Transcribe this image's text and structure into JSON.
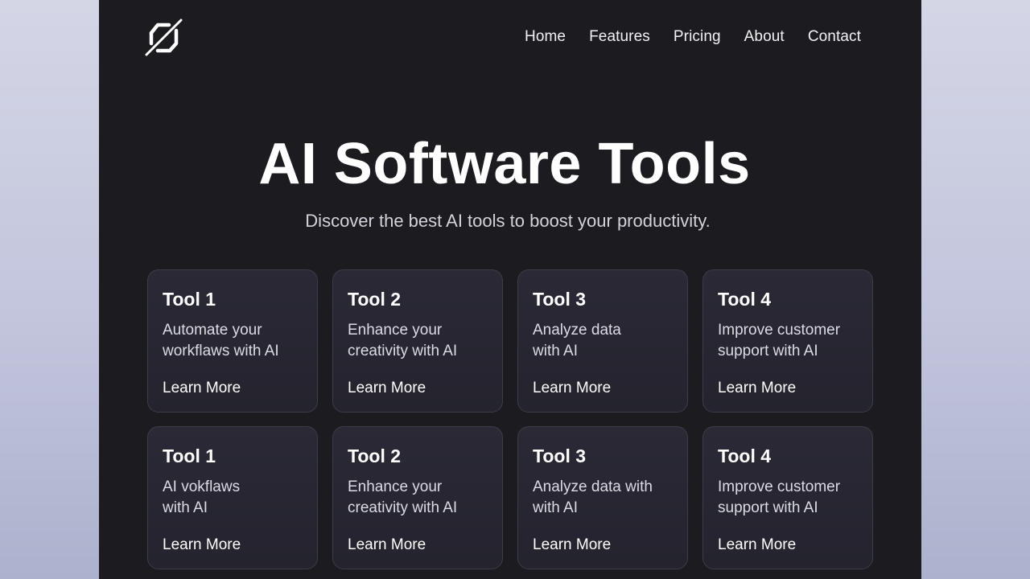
{
  "nav": {
    "links": [
      "Home",
      "Features",
      "Pricing",
      "About",
      "Contact"
    ]
  },
  "hero": {
    "title": "AI Software Tools",
    "subtitle": "Discover the best AI tools to boost your productivity."
  },
  "cards": [
    {
      "title": "Tool 1",
      "description": "Automate your\nworkflaws with AI",
      "link": "Learn More"
    },
    {
      "title": "Tool 2",
      "description": "Enhance your\ncreativity with AI",
      "link": "Learn More"
    },
    {
      "title": "Tool 3",
      "description": "Analyze data\nwith AI",
      "link": "Learn More"
    },
    {
      "title": "Tool 4",
      "description": "Improve customer\nsupport with AI",
      "link": "Learn More"
    },
    {
      "title": "Tool 1",
      "description": "AI vokflaws\nwith AI",
      "link": "Learn More"
    },
    {
      "title": "Tool 2",
      "description": "Enhance your\ncreativity with AI",
      "link": "Learn More"
    },
    {
      "title": "Tool 3",
      "description": "Analyze data with\nwith AI",
      "link": "Learn More"
    },
    {
      "title": "Tool 4",
      "description": "Improve customer\nsupport with AI",
      "link": "Learn More"
    }
  ],
  "colors": {
    "page_background": "#1c1b20",
    "card_background": "#272632",
    "card_border": "#3d3c48",
    "text_primary": "#ffffff",
    "text_secondary": "#d3d3dc"
  },
  "icons": {
    "logo": "slashed-square-logo-icon"
  }
}
